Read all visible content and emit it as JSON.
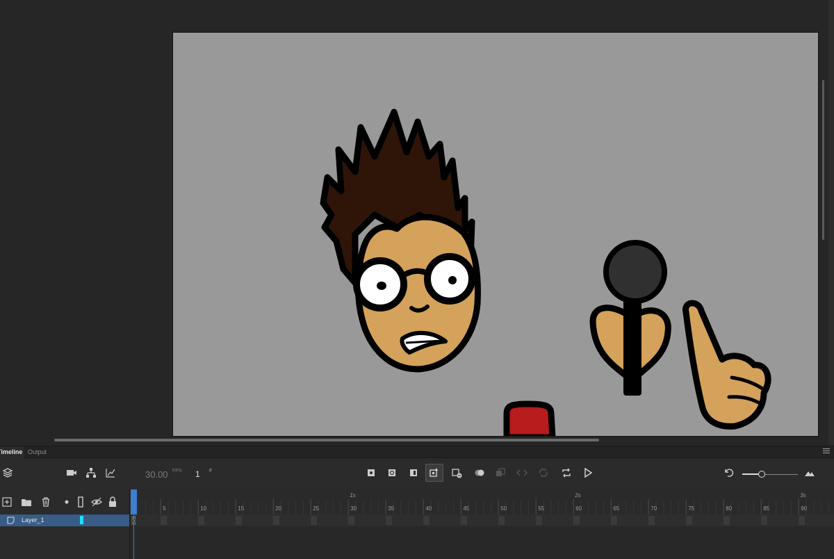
{
  "timeline": {
    "tabs": [
      {
        "label": "Timeline",
        "active": true
      },
      {
        "label": "Output",
        "active": false
      }
    ],
    "fps_value": "30.00",
    "fps_unit": "FPS",
    "frame_value": "1",
    "frame_unit": "F",
    "zoom_level": 0.35,
    "ruler": {
      "frame_ticks": [
        "5",
        "10",
        "15",
        "20",
        "25",
        "30",
        "35",
        "40",
        "45",
        "50",
        "55",
        "60",
        "65",
        "70",
        "75",
        "80",
        "85",
        "90"
      ],
      "seconds": [
        "1s",
        "2s",
        "3s"
      ]
    },
    "layers": [
      {
        "name": "Layer_1",
        "color": "#1ee0ff",
        "selected": true
      }
    ]
  },
  "colors": {
    "stage_bg": "#999999",
    "hair": "#2e1508",
    "skin": "#d4a25a",
    "mic_head": "#303030",
    "red_cup": "#b81c1c",
    "playhead": "#3d7fd1",
    "layer_selected": "#395c87"
  },
  "icons": {
    "layers": "layers-icon",
    "camera": "camera-icon",
    "hierarchy": "hierarchy-icon",
    "graph": "graph-icon",
    "play": "play-icon",
    "loop": "loop-icon",
    "undo": "undo-icon"
  }
}
